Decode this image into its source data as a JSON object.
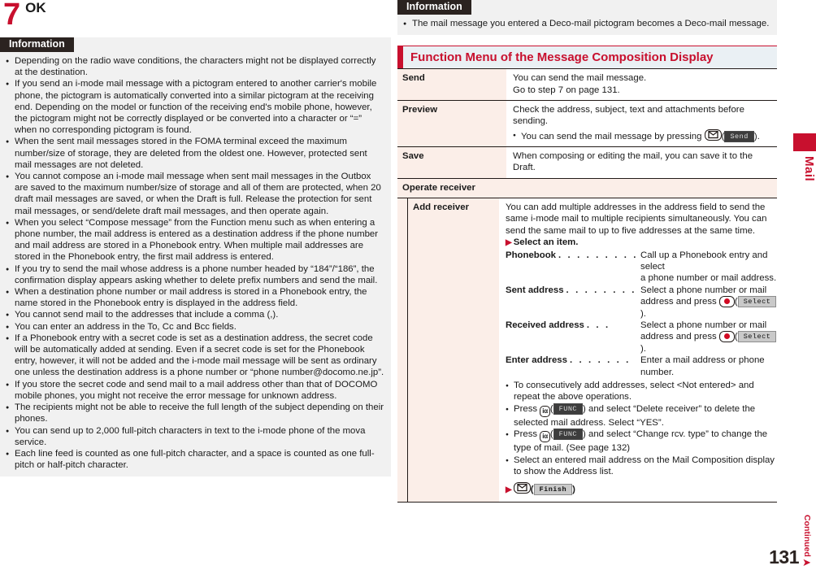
{
  "left": {
    "step": {
      "number": "7",
      "label": "OK"
    },
    "information": {
      "tag": "Information",
      "items": [
        "Depending on the radio wave conditions, the characters might not be displayed correctly at the destination.",
        "If you send an i-mode mail message with a pictogram entered to another carrier's mobile phone, the pictogram is automatically converted into a similar pictogram at the receiving end. Depending on the model or function of the receiving end's mobile phone, however, the pictogram might not be correctly displayed or be converted into a character or “=” when no corresponding pictogram is found.",
        "When the sent mail messages stored in the FOMA terminal exceed the maximum number/size of storage, they are deleted from the oldest one. However, protected sent mail messages are not deleted.",
        "You cannot compose an i-mode mail message when sent mail messages in the Outbox are saved to the maximum number/size of storage and all of them are protected, when 20 draft mail messages are saved, or when the Draft is full. Release the protection for sent mail messages, or send/delete draft mail messages, and then operate again.",
        "When you select “Compose message” from the Function menu such as when entering a phone number, the mail address is entered as a destination address if the phone number and mail address are stored in a Phonebook entry. When multiple mail addresses are stored in the Phonebook entry, the first mail address is entered.",
        "If you try to send the mail whose address is a phone number headed by “184”/“186”, the confirmation display appears asking whether to delete prefix numbers and send the mail.",
        "When a destination phone number or mail address is stored in a Phonebook entry, the name stored in the Phonebook entry is displayed in the address field.",
        "You cannot send mail to the addresses that include a comma (,).",
        "You can enter an address in the To, Cc and Bcc fields.",
        "If a Phonebook entry with a secret code is set as a destination address, the secret code will be automatically added at sending. Even if a secret code is set for the Phonebook entry, however, it will not be added and the i-mode mail message will be sent as ordinary one unless the destination address is a phone number or “phone number@docomo.ne.jp”.",
        "If you store the secret code and send mail to a mail address other than that of DOCOMO mobile phones, you might not receive the error message for unknown address.",
        "The recipients might not be able to receive the full length of the subject depending on their phones.",
        "You can send up to 2,000 full-pitch characters in text to the i-mode phone of the mova service.",
        "Each line feed is counted as one full-pitch character, and a space is counted as one full-pitch or half-pitch character."
      ]
    }
  },
  "right": {
    "information": {
      "tag": "Information",
      "items": [
        "The mail message you entered a Deco-mail pictogram becomes a Deco-mail message."
      ]
    },
    "section_header": "Function Menu of the Message Composition Display",
    "table": {
      "rows": [
        {
          "key": "Send",
          "lines": [
            "You can send the mail message.",
            "Go to step 7 on page 131."
          ]
        },
        {
          "key": "Preview",
          "lines": [
            "Check the address, subject, text and attachments before sending."
          ],
          "bullet_before": "You can send the mail message by pressing ",
          "bullet_key_icon": "mail-key-icon",
          "bullet_softkey": "Send",
          "bullet_after": ")."
        },
        {
          "key": "Save",
          "lines": [
            "When composing or editing the mail, you can save it to the Draft."
          ]
        }
      ],
      "group_row": "Operate receiver",
      "sub_row": {
        "key": "Add receiver",
        "intro": "You can add multiple addresses in the address field to send the same i-mode mail to multiple recipients simultaneously. You can send the same mail to up to five addresses at the same time.",
        "select_line": "Select an item.",
        "definitions": [
          {
            "term": "Phonebook",
            "dots": ". . . . . . . . .",
            "desc_lines": [
              "Call up a Phonebook entry and select",
              "a phone number or mail address."
            ]
          },
          {
            "term": "Sent address",
            "dots": ". . . . . . . .",
            "desc_lines": [
              "Select a phone number or mail",
              "address and press "
            ],
            "key_icon": "center-key-icon",
            "softkey": "Select",
            "tail": ")."
          },
          {
            "term": "Received address",
            "dots": ". . .",
            "desc_lines": [
              "Select a phone number or mail",
              "address and press "
            ],
            "key_icon": "center-key-icon",
            "softkey": "Select",
            "tail": ")."
          },
          {
            "term": "Enter address",
            "dots": ". . . . . . .",
            "desc_lines": [
              "Enter a mail address or phone",
              "number."
            ]
          }
        ],
        "bullets": [
          {
            "text_before": "To consecutively add addresses, select <Not entered> and repeat the above operations."
          },
          {
            "text_before": "Press ",
            "key_icon": "func-key-icon",
            "softkey": "FUNC",
            "text_after": ") and select “Delete receiver” to delete the selected mail address. Select “YES”."
          },
          {
            "text_before": "Press ",
            "key_icon": "func-key-icon",
            "softkey": "FUNC",
            "text_after": ") and select “Change rcv. type” to change the type of mail. (See page 132)"
          },
          {
            "text_before": "Select an entered mail address on the Mail Composition display to show the Address list."
          }
        ],
        "finish_line": {
          "key_icon": "mail-key-icon",
          "softkey": "Finish",
          "tail": ")"
        }
      }
    }
  },
  "side_tab": {
    "label": "Mail"
  },
  "footer": {
    "page_number": "131",
    "continued": "Continued",
    "arrow": "➜"
  },
  "colors": {
    "accent_red": "#c8102e",
    "info_tag_bg": "#2b2320",
    "info_body_bg": "#f1f1f1",
    "table_key_bg": "#fbeee8",
    "section_header_bg": "#eaf0f4"
  }
}
